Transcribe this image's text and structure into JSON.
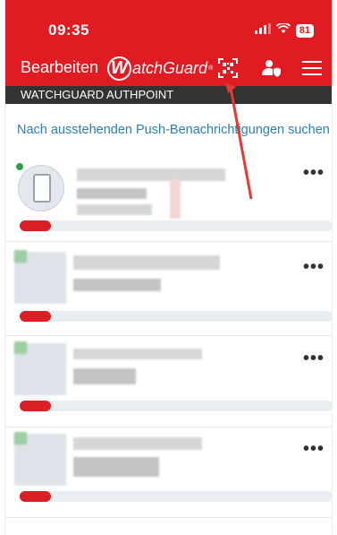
{
  "status_bar": {
    "time": "09:35",
    "battery": "81"
  },
  "toolbar": {
    "edit_label": "Bearbeiten",
    "logo_text": "atchGuard",
    "logo_letter": "W",
    "logo_mark": "®"
  },
  "app_bar": {
    "title": "WATCHGUARD AUTHPOINT"
  },
  "search": {
    "label": "Nach ausstehenden Push-Benachrichtigungen suchen"
  },
  "tokens": [
    {
      "more_label": "•••",
      "progress": 0.1
    },
    {
      "more_label": "•••",
      "progress": 0.1
    },
    {
      "more_label": "•••",
      "progress": 0.1
    },
    {
      "more_label": "•••",
      "progress": 0.1
    }
  ],
  "colors": {
    "brand": "#e11b22",
    "app_bar": "#333333",
    "link": "#2d7fae",
    "status_dot": "#2ea043"
  },
  "icons": [
    "signal-icon",
    "wifi-icon",
    "qr-scan-icon",
    "user-shield-icon",
    "hamburger-menu-icon",
    "more-options-icon",
    "smartphone-icon"
  ]
}
